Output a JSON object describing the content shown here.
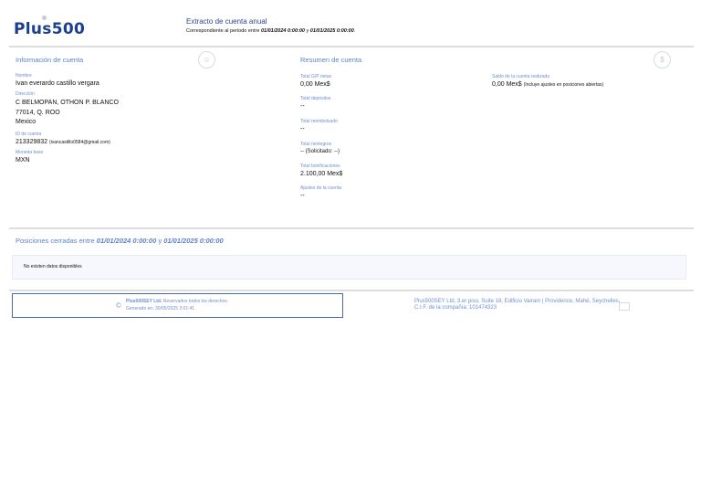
{
  "header": {
    "logo": "Plus500",
    "title": "Extracto de cuenta anual",
    "subtitle_prefix": "Correspondiente al periodo entre ",
    "date_from": "01/01/2024 0:00:00",
    "and": " y ",
    "date_to": "01/01/2025 0:00:00",
    "period_end": "."
  },
  "account_info": {
    "title": "Información de cuenta",
    "icon": "user-icon",
    "name_label": "Nombre",
    "name": "Ivan everardo castillo vergara",
    "address_label": "Dirección",
    "address_lines": [
      "C BELMOPAN, OTHON P. BLANCO",
      "77014, Q. ROO",
      "Mexico"
    ],
    "id_label": "ID de cuenta",
    "id": "213329832",
    "email": "(ivancastillo0584@gmail.com)",
    "currency_label": "Moneda base",
    "currency": "MXN"
  },
  "summary": {
    "title": "Resumen de cuenta",
    "icon": "money-icon",
    "items": [
      {
        "label": "Total G/P netas",
        "value": "0,00 Mex$"
      },
      {
        "label": "Total depósitos",
        "value": "--"
      },
      {
        "label": "Total reembolsado",
        "value": "--"
      },
      {
        "label": "Total reintegros",
        "value": "-- (Solicitado: --)"
      },
      {
        "label": "Total bonificaciones",
        "value": "2.100,00 Mex$"
      },
      {
        "label": "Ajustes de la cuenta",
        "value": "--"
      }
    ],
    "balance_label": "Saldo de la cuenta realizado",
    "balance": "0,00 Mex$",
    "balance_note": "(Incluye ajustes en posiciones abiertas)"
  },
  "closed_positions": {
    "title_prefix": "Posiciones cerradas entre ",
    "date_from": "01/01/2024 0:00:00",
    "and": " y ",
    "date_to": "01/01/2025 0:00:00",
    "empty": "No existen datos disponibles"
  },
  "footer": {
    "copyright_symbol": "©",
    "company": "Plus500SEY Ltd.",
    "rights": " Reservados todos los derechos.",
    "generated": "Generado en: 30/05/2025 2:01:41",
    "address": "Plus500SEY Ltd, 3.er piso, Suite 18, Edificio Vairam | Providence, Mahé, Seychelles.",
    "cif": "C.I.F. de la compañía: 101474323",
    "icon": "mail-icon"
  }
}
